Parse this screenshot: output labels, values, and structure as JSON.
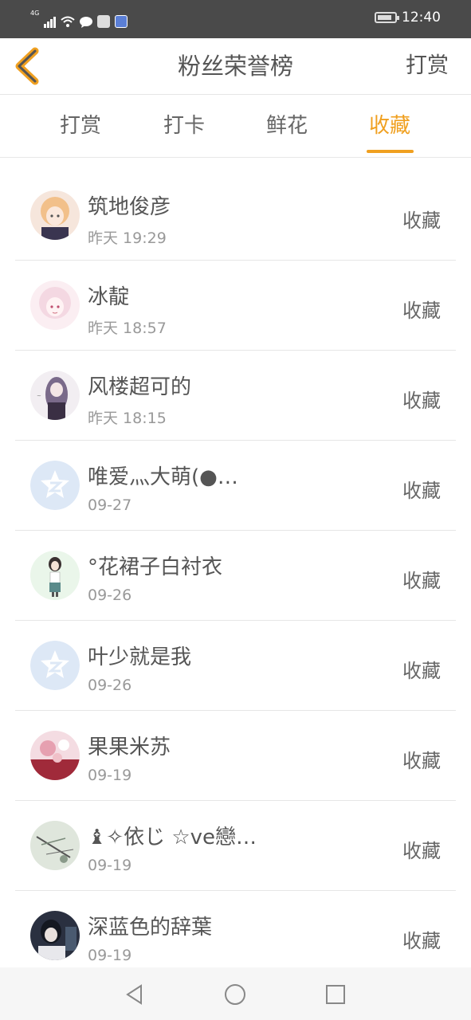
{
  "status_bar": {
    "network": "4G",
    "time": "12:40"
  },
  "header": {
    "title": "粉丝荣誉榜",
    "action_label": "打赏",
    "back_icon": "chevron-left-icon",
    "accent_color": "#f0a020"
  },
  "tabs": [
    {
      "label": "打赏",
      "active": false
    },
    {
      "label": "打卡",
      "active": false
    },
    {
      "label": "鲜花",
      "active": false
    },
    {
      "label": "收藏",
      "active": true
    }
  ],
  "list": [
    {
      "name": "筑地俊彦",
      "time": "昨天 19:29",
      "action": "收藏",
      "avatar": "anime-avatar-1"
    },
    {
      "name": "冰靛",
      "time": "昨天 18:57",
      "action": "收藏",
      "avatar": "anime-avatar-2"
    },
    {
      "name": "风楼超可的",
      "time": "昨天 18:15",
      "action": "收藏",
      "avatar": "anime-avatar-3"
    },
    {
      "name": "唯爱灬大萌(●…",
      "time": "09-27",
      "action": "收藏",
      "avatar": "default-avatar"
    },
    {
      "name": "°花裙子白衬衣",
      "time": "09-26",
      "action": "收藏",
      "avatar": "girl-avatar"
    },
    {
      "name": "叶少就是我",
      "time": "09-26",
      "action": "收藏",
      "avatar": "default-avatar"
    },
    {
      "name": "果果米苏",
      "time": "09-19",
      "action": "收藏",
      "avatar": "photo-avatar-1"
    },
    {
      "name": "♝✧依じ ☆ve戀…",
      "time": "09-19",
      "action": "收藏",
      "avatar": "photo-avatar-2"
    },
    {
      "name": "深蓝色的辞葉",
      "time": "09-19",
      "action": "收藏",
      "avatar": "photo-avatar-3"
    }
  ],
  "nav_bar": {
    "back_icon": "triangle-back-icon",
    "home_icon": "circle-home-icon",
    "recent_icon": "square-recent-icon"
  }
}
